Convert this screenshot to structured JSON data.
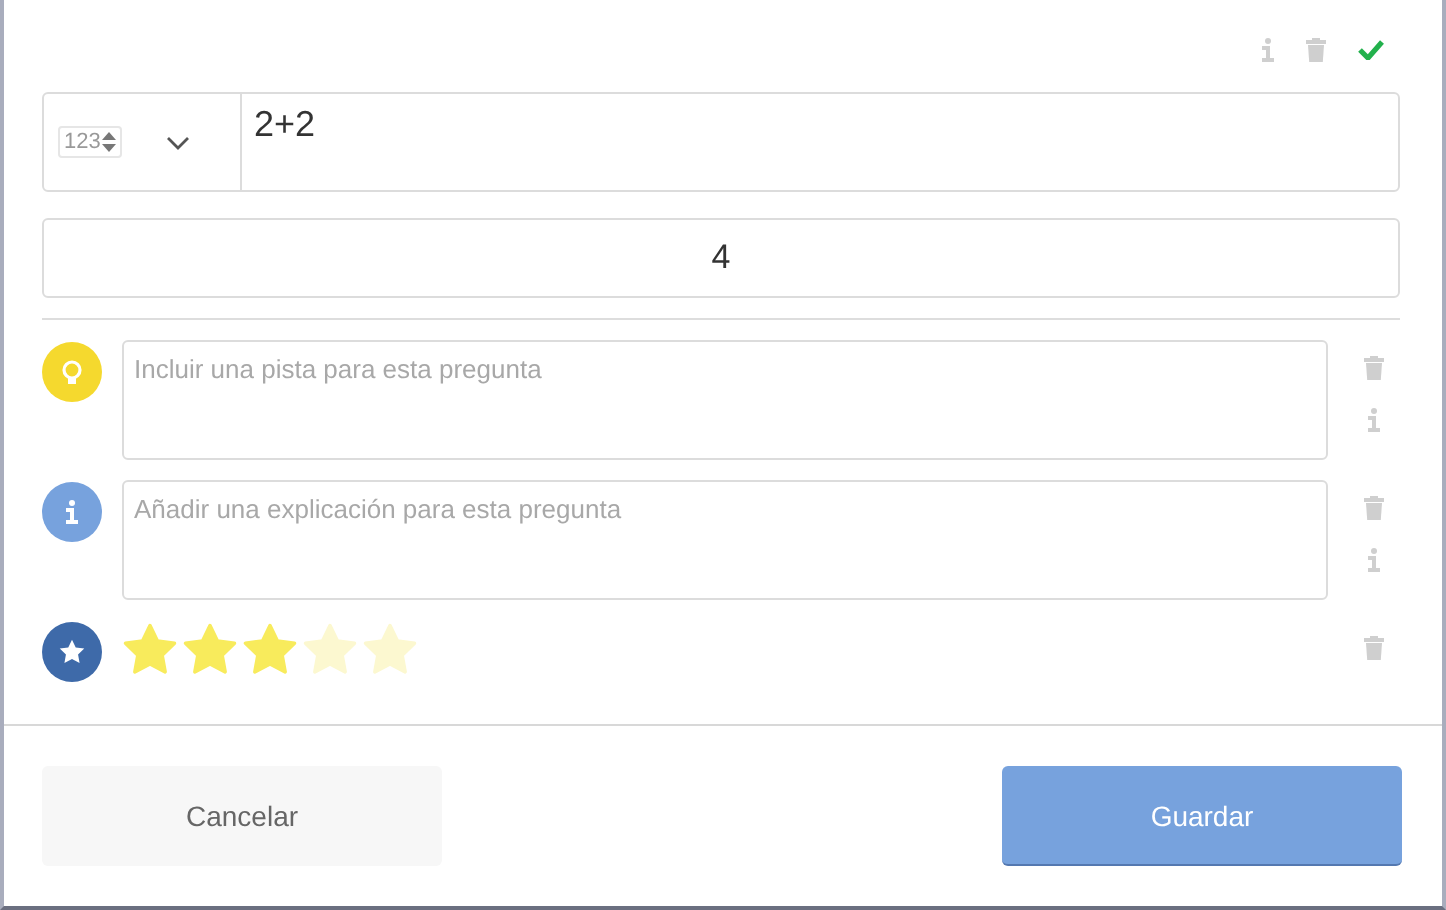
{
  "header_actions": {
    "confirmed": true
  },
  "expression": {
    "type_label": "123",
    "value": "2+2"
  },
  "answer": {
    "value": "4"
  },
  "hint": {
    "placeholder": "Incluir una pista para esta pregunta"
  },
  "explanation": {
    "placeholder": "Añadir una explicación para esta pregunta"
  },
  "difficulty": {
    "stars": 3
  },
  "buttons": {
    "cancel": "Cancelar",
    "save": "Guardar"
  }
}
